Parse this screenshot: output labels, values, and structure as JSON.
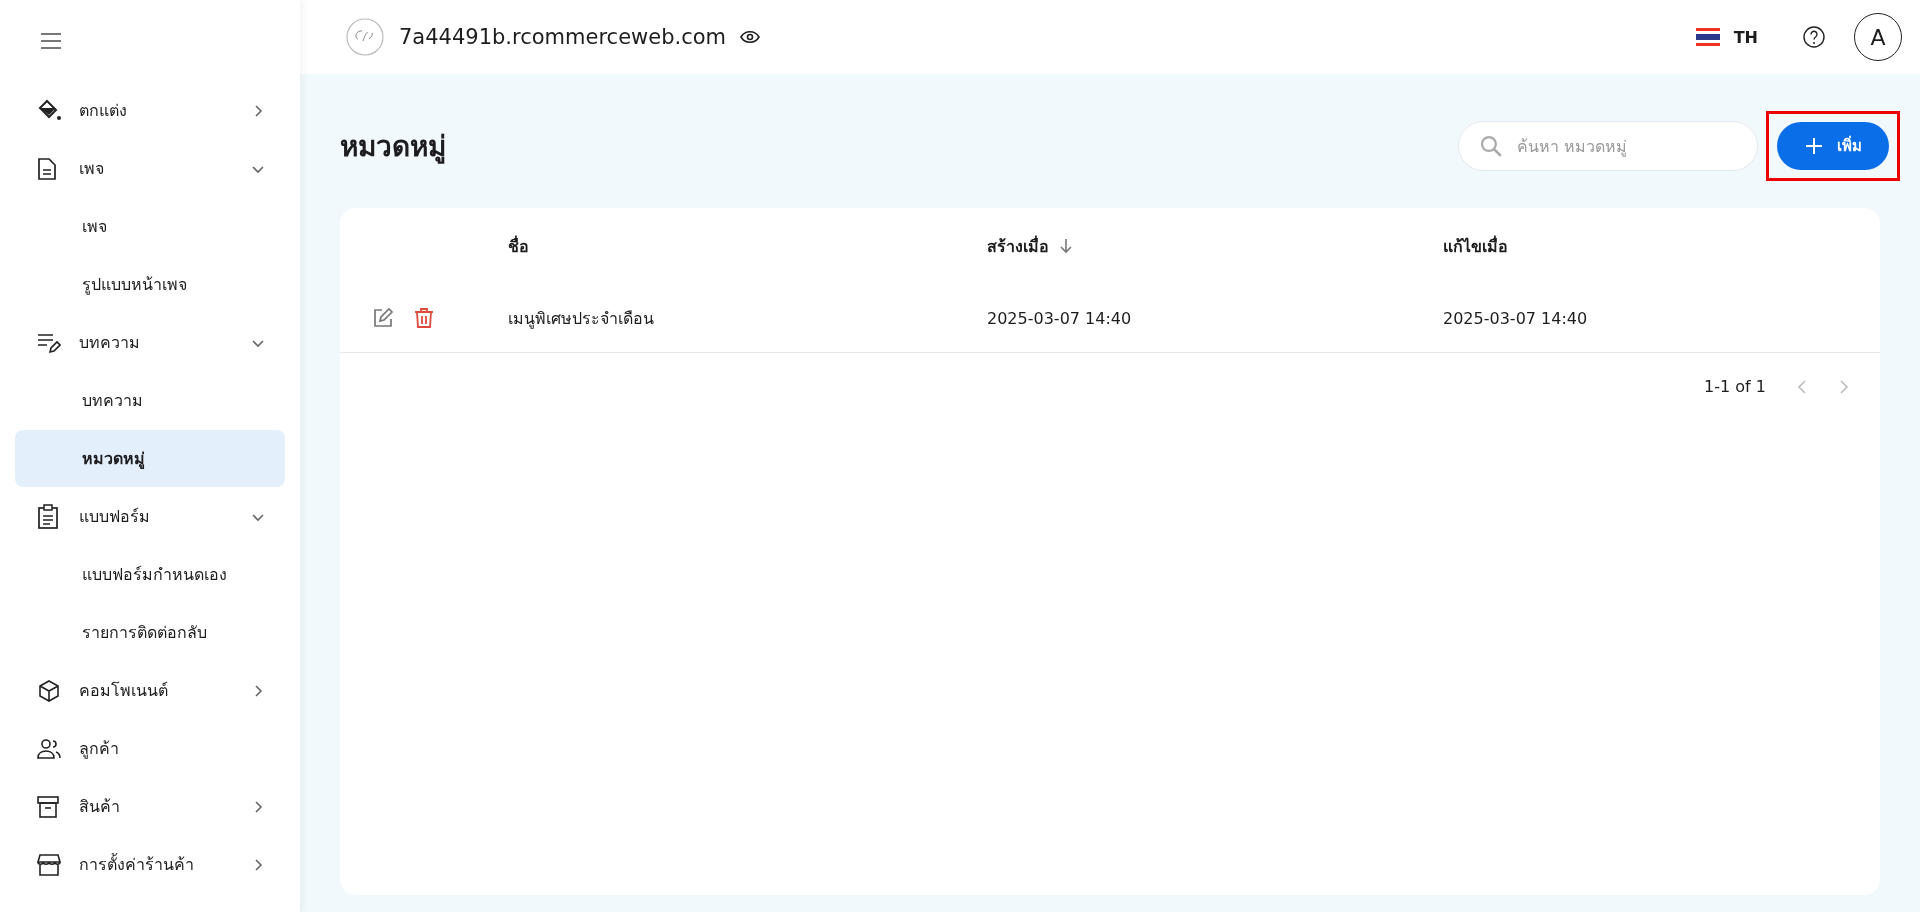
{
  "header": {
    "site_name": "7a44491b.rcommerceweb.com",
    "language": "TH",
    "avatar_letter": "A"
  },
  "sidebar": {
    "items": [
      {
        "kind": "group",
        "label": "ตกแต่ง",
        "expanded": false
      },
      {
        "kind": "group",
        "label": "เพจ",
        "expanded": true,
        "children": [
          {
            "label": "เพจ",
            "selected": false
          },
          {
            "label": "รูปแบบหน้าเพจ",
            "selected": false
          }
        ]
      },
      {
        "kind": "group",
        "label": "บทความ",
        "expanded": true,
        "children": [
          {
            "label": "บทความ",
            "selected": false
          },
          {
            "label": "หมวดหมู่",
            "selected": true
          }
        ]
      },
      {
        "kind": "group",
        "label": "แบบฟอร์ม",
        "expanded": true,
        "children": [
          {
            "label": "แบบฟอร์มกำหนดเอง",
            "selected": false
          },
          {
            "label": "รายการติดต่อกลับ",
            "selected": false
          }
        ]
      },
      {
        "kind": "group",
        "label": "คอมโพเนนต์",
        "expanded": false
      },
      {
        "kind": "link",
        "label": "ลูกค้า"
      },
      {
        "kind": "group",
        "label": "สินค้า",
        "expanded": false
      },
      {
        "kind": "group",
        "label": "การตั้งค่าร้านค้า",
        "expanded": false
      }
    ]
  },
  "page": {
    "title": "หมวดหมู่",
    "search": {
      "placeholder": "ค้นหา หมวดหมู่"
    },
    "add_button": "เพิ่ม",
    "add_button_highlighted": true
  },
  "table": {
    "columns": [
      {
        "label": "ชื่อ",
        "sorted": false
      },
      {
        "label": "สร้างเมื่อ",
        "sorted": true
      },
      {
        "label": "แก้ไขเมื่อ",
        "sorted": false
      }
    ],
    "rows": [
      {
        "name": "เมนูพิเศษประจำเดือน",
        "created": "2025-03-07 14:40",
        "updated": "2025-03-07 14:40"
      }
    ],
    "pagination": {
      "range": "1-1 of 1",
      "prev_disabled": true,
      "next_disabled": true
    }
  }
}
